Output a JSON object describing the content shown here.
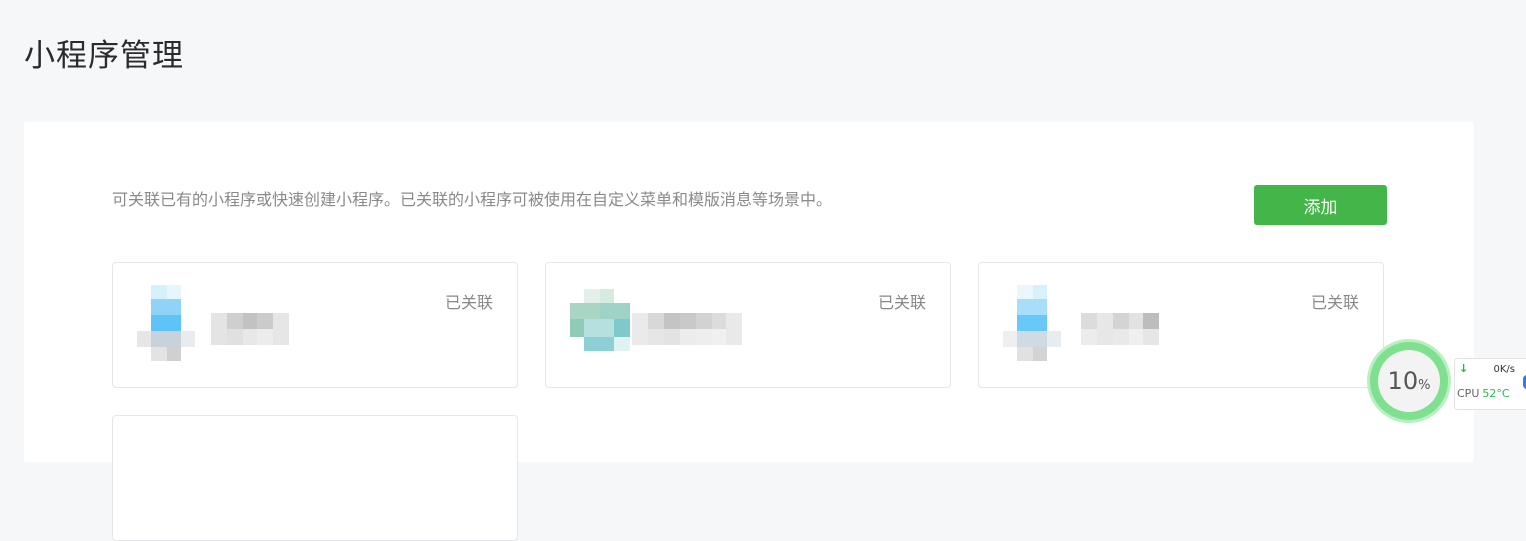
{
  "page": {
    "title": "小程序管理"
  },
  "panel": {
    "description": "可关联已有的小程序或快速创建小程序。已关联的小程序可被使用在自定义菜单和模版消息等场景中。",
    "add_label": "添加"
  },
  "cards": [
    {
      "status": "已关联"
    },
    {
      "status": "已关联"
    },
    {
      "status": "已关联"
    }
  ],
  "widget": {
    "cpu_percent": "10",
    "percent_sign": "%",
    "net_speed": "0K/s",
    "cpu_label": "CPU",
    "cpu_temp": "52°C"
  },
  "colors": {
    "accent": "#44b549",
    "background": "#f6f7f9",
    "card_border": "#e4e6e9"
  }
}
